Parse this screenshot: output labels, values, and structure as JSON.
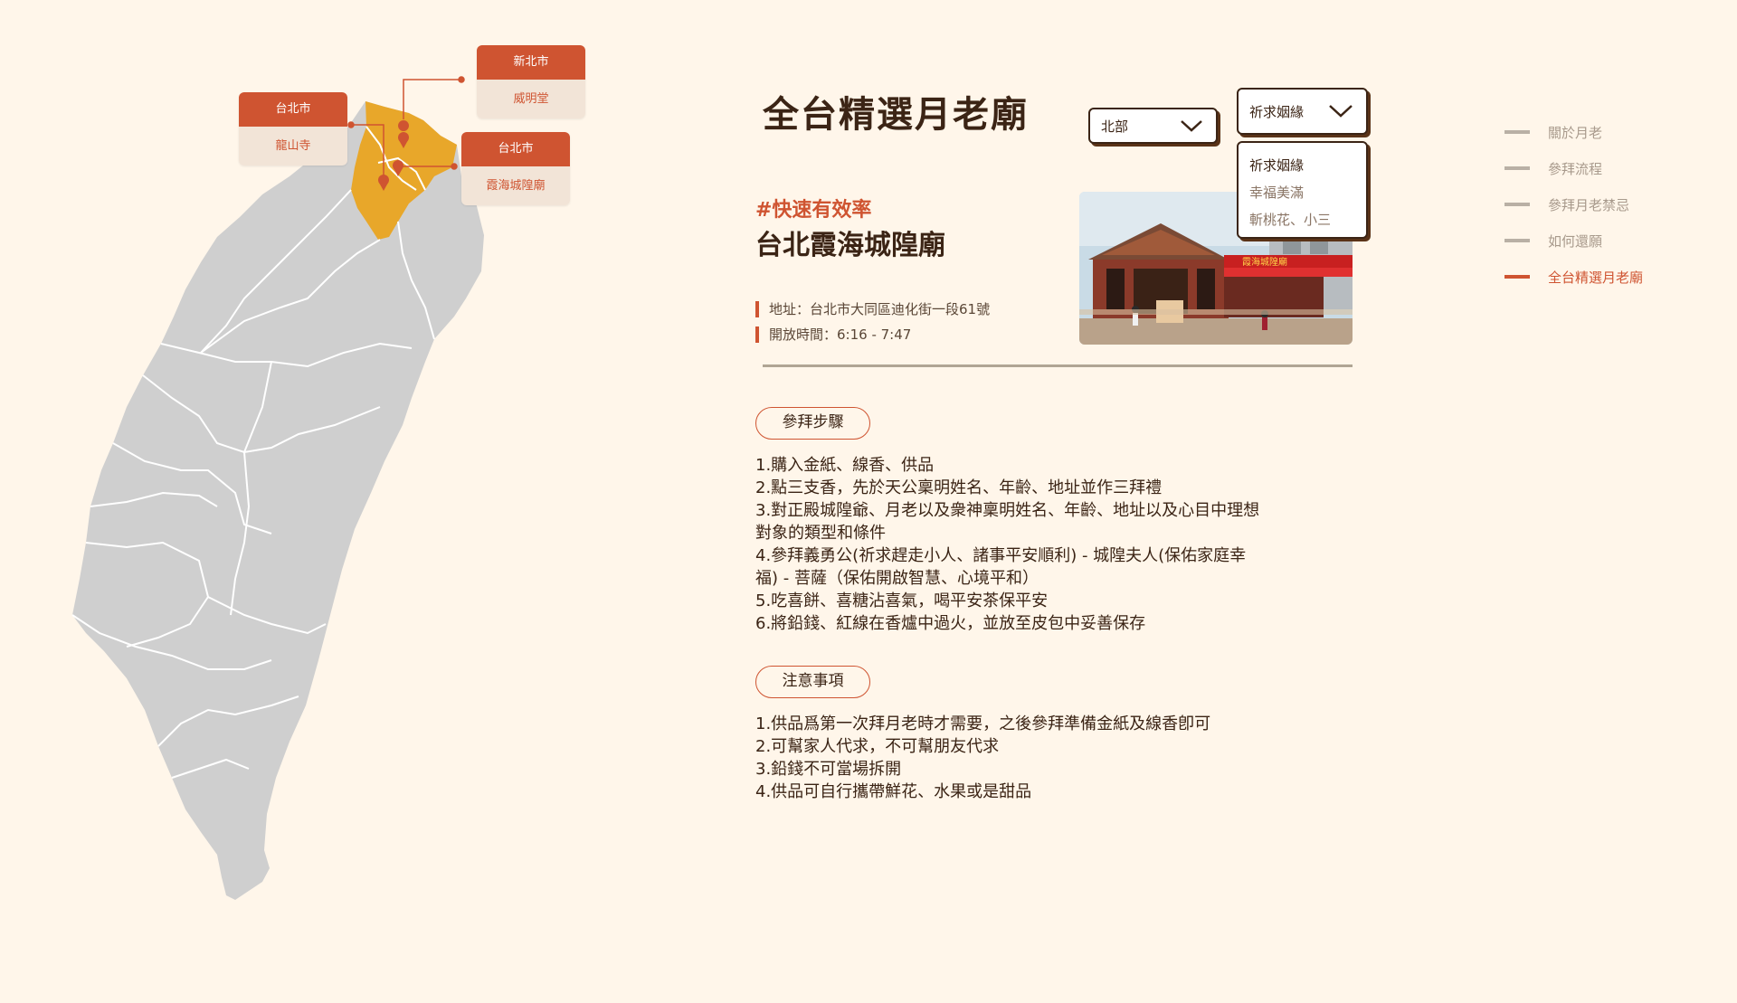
{
  "map": {
    "cards": [
      {
        "city": "新北市",
        "temple": "威明堂"
      },
      {
        "city": "台北市",
        "temple": "龍山寺"
      },
      {
        "city": "台北市",
        "temple": "霞海城隍廟"
      }
    ],
    "colors": {
      "land": "#cfcfcf",
      "highlight": "#e8a72a",
      "marker": "#cf5431",
      "border": "#ffffff"
    }
  },
  "page": {
    "title": "全台精選月老廟"
  },
  "filters": {
    "region": {
      "selected": "北部",
      "icon": "chevron-down-icon"
    },
    "wish": {
      "selected": "祈求姻緣",
      "icon": "chevron-down-icon",
      "options": [
        "祈求姻緣",
        "幸福美滿",
        "斬桃花、小三"
      ]
    }
  },
  "temple": {
    "tag": "#快速有效率",
    "name": "台北霞海城隍廟",
    "address": "地址：台北市大同區迪化街一段61號",
    "hours": "開放時間：6:16 - 7:47",
    "photo_sign": "霞海城隍廟"
  },
  "steps": {
    "heading": "參拜步驟",
    "items": [
      "1.購入金紙、線香、供品",
      "2.點三支香，先於天公稟明姓名、年齡、地址並作三拜禮",
      "3.對正殿城隍爺、月老以及衆神稟明姓名、年齡、地址以及心目中理想對象的類型和條件",
      "4.參拜義勇公(祈求趕走小人、諸事平安順利) - 城隍夫人(保佑家庭幸福) - 菩薩（保佑開啟智慧、心境平和）",
      "5.吃喜餅、喜糖沾喜氣，喝平安茶保平安",
      "6.將鉛錢、紅線在香爐中過火，並放至皮包中妥善保存"
    ]
  },
  "notes": {
    "heading": "注意事項",
    "items": [
      "1.供品爲第一次拜月老時才需要，之後參拜準備金紙及線香卽可",
      "2.可幫家人代求，不可幫朋友代求",
      "3.鉛錢不可當場拆開",
      "4.供品可自行攜帶鮮花、水果或是甜品"
    ]
  },
  "nav": {
    "items": [
      "關於月老",
      "參拜流程",
      "參拜月老禁忌",
      "如何還願",
      "全台精選月老廟"
    ],
    "active_index": 4
  },
  "colors": {
    "accent": "#cf5431",
    "text_dark": "#3b2415",
    "background": "#fff6ea"
  }
}
